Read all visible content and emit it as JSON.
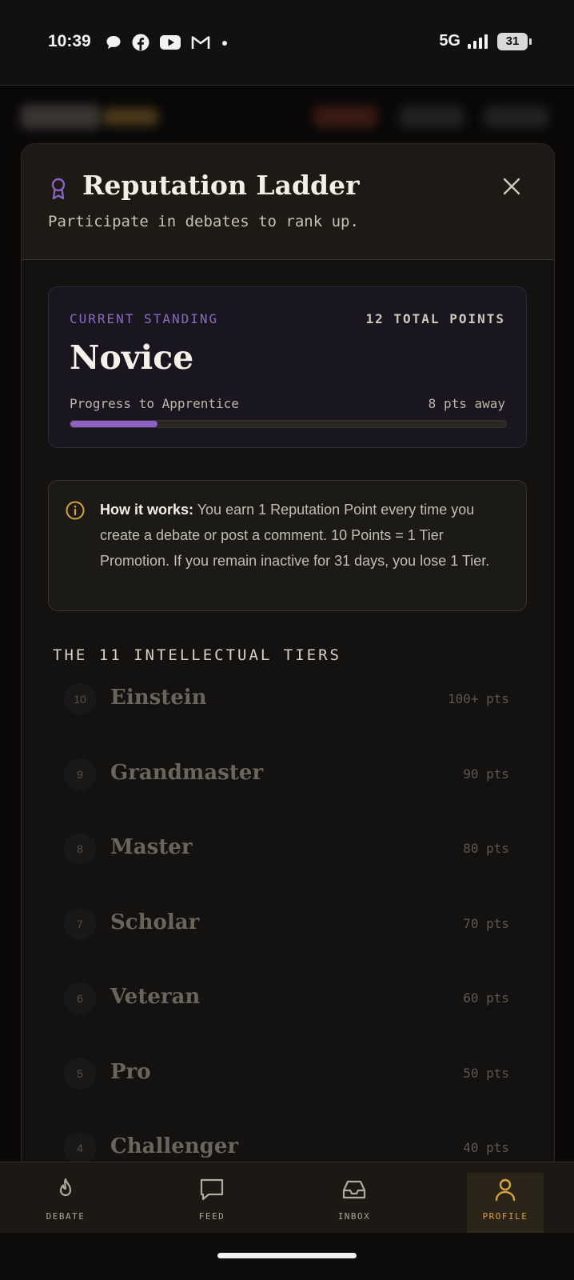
{
  "status_bar": {
    "time": "10:39",
    "network": "5G",
    "battery": "31",
    "notification_icons": [
      "chat-bubble-icon",
      "facebook-icon",
      "youtube-icon",
      "gmail-icon",
      "dot-icon"
    ]
  },
  "modal": {
    "title": "Reputation Ladder",
    "subtitle": "Participate in debates to rank up.",
    "icon": "award-icon"
  },
  "standing": {
    "label": "CURRENT STANDING",
    "total_points": "12 TOTAL POINTS",
    "rank": "Novice",
    "progress_label": "Progress to Apprentice",
    "progress_away": "8 pts away",
    "progress_fraction": 0.2
  },
  "info": {
    "lead": "How it works:",
    "text": " You earn 1 Reputation Point every time you create a debate or post a comment. 10 Points = 1 Tier Promotion. If you remain inactive for 31 days, you lose 1 Tier."
  },
  "tiers": {
    "title": "THE 11 INTELLECTUAL TIERS",
    "items": [
      {
        "num": "10",
        "name": "Einstein",
        "pts": "100+ pts"
      },
      {
        "num": "9",
        "name": "Grandmaster",
        "pts": "90 pts"
      },
      {
        "num": "8",
        "name": "Master",
        "pts": "80 pts"
      },
      {
        "num": "7",
        "name": "Scholar",
        "pts": "70 pts"
      },
      {
        "num": "6",
        "name": "Veteran",
        "pts": "60 pts"
      },
      {
        "num": "5",
        "name": "Pro",
        "pts": "50 pts"
      },
      {
        "num": "4",
        "name": "Challenger",
        "pts": "40 pts"
      }
    ]
  },
  "nav": {
    "items": [
      {
        "label": "DEBATE",
        "icon": "flame-icon"
      },
      {
        "label": "FEED",
        "icon": "chat-icon"
      },
      {
        "label": "INBOX",
        "icon": "inbox-icon"
      },
      {
        "label": "PROFILE",
        "icon": "user-icon",
        "active": true
      }
    ]
  },
  "colors": {
    "accent_purple": "#8a62c4",
    "accent_gold": "#d6a23c",
    "background": "#0d0c0b"
  }
}
